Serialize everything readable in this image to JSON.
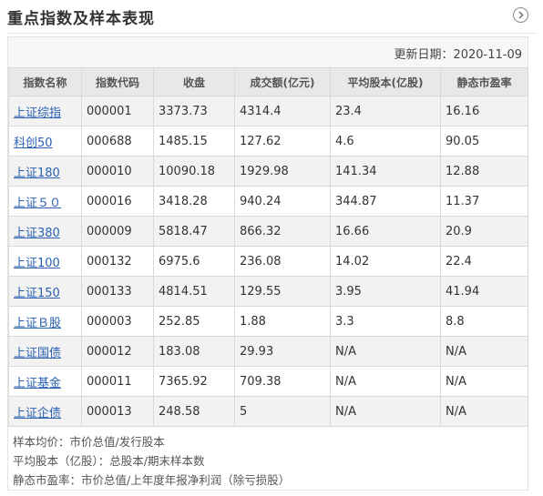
{
  "header": {
    "title": "重点指数及样本表现"
  },
  "update": {
    "label": "更新日期：2020-11-09"
  },
  "table": {
    "columns": [
      "指数名称",
      "指数代码",
      "收盘",
      "成交额(亿元)",
      "平均股本(亿股)",
      "静态市盈率"
    ],
    "rows": [
      {
        "name": "上证综指",
        "code": "000001",
        "close": "3373.73",
        "turnover": "4314.4",
        "avg_shares": "23.4",
        "pe": "16.16"
      },
      {
        "name": "科创50",
        "code": "000688",
        "close": "1485.15",
        "turnover": "127.62",
        "avg_shares": "4.6",
        "pe": "90.05"
      },
      {
        "name": "上证180",
        "code": "000010",
        "close": "10090.18",
        "turnover": "1929.98",
        "avg_shares": "141.34",
        "pe": "12.88"
      },
      {
        "name": "上证５０",
        "code": "000016",
        "close": "3418.28",
        "turnover": "940.24",
        "avg_shares": "344.87",
        "pe": "11.37"
      },
      {
        "name": "上证380",
        "code": "000009",
        "close": "5818.47",
        "turnover": "866.32",
        "avg_shares": "16.66",
        "pe": "20.9"
      },
      {
        "name": "上证100",
        "code": "000132",
        "close": "6975.6",
        "turnover": "236.08",
        "avg_shares": "14.02",
        "pe": "22.4"
      },
      {
        "name": "上证150",
        "code": "000133",
        "close": "4814.51",
        "turnover": "129.55",
        "avg_shares": "3.95",
        "pe": "41.94"
      },
      {
        "name": "上证Ｂ股",
        "code": "000003",
        "close": "252.85",
        "turnover": "1.88",
        "avg_shares": "3.3",
        "pe": "8.8"
      },
      {
        "name": "上证国债",
        "code": "000012",
        "close": "183.08",
        "turnover": "29.93",
        "avg_shares": "N/A",
        "pe": "N/A"
      },
      {
        "name": "上证基金",
        "code": "000011",
        "close": "7365.92",
        "turnover": "709.38",
        "avg_shares": "N/A",
        "pe": "N/A"
      },
      {
        "name": "上证企债",
        "code": "000013",
        "close": "248.58",
        "turnover": "5",
        "avg_shares": "N/A",
        "pe": "N/A"
      }
    ]
  },
  "notes": [
    "样本均价：市价总值/发行股本",
    "平均股本（亿股）：总股本/期末样本数",
    "静态市盈率：市价总值/上年度年报净利润（除亏损股）"
  ],
  "icons": {
    "more": "chevron-right-circle-icon"
  },
  "colors": {
    "link": "#2a61b3",
    "header_bg": "#e8e8e8",
    "stripe_bg": "#f2f2f2"
  }
}
